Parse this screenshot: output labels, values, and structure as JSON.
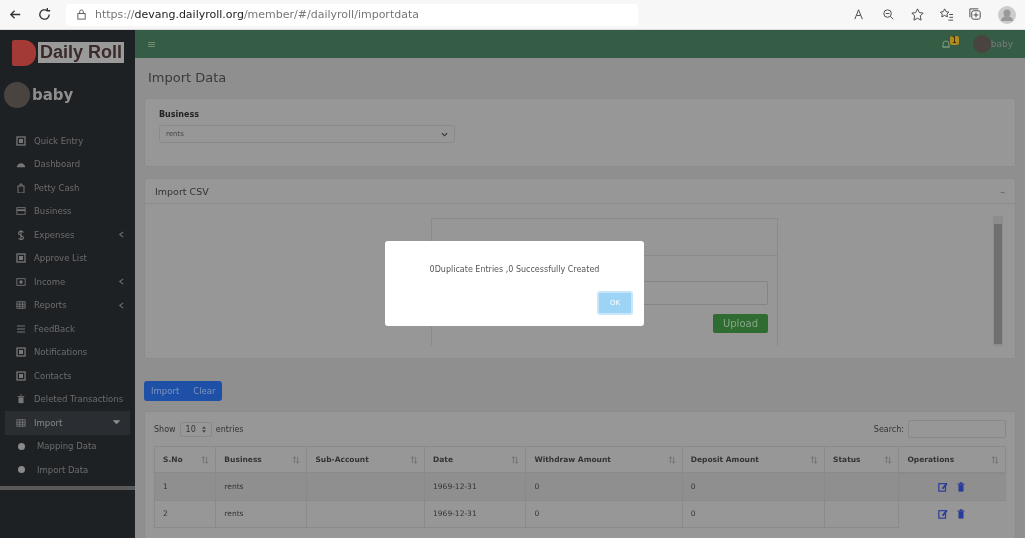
{
  "browser": {
    "url": "https://**devang.dailyroll.org**/member/#/dailyroll/importdata"
  },
  "sidebar": {
    "logo": "Daily Roll",
    "user": "baby",
    "items": [
      {
        "label": "Quick Entry",
        "kind": "link",
        "selected": false
      },
      {
        "label": "Dashboard",
        "kind": "link",
        "selected": false
      },
      {
        "label": "Petty Cash",
        "kind": "link",
        "selected": false
      },
      {
        "label": "Business",
        "kind": "link",
        "selected": false
      },
      {
        "label": "Expenses",
        "kind": "group",
        "expanded": false,
        "selected": false
      },
      {
        "label": "Approve List",
        "kind": "link",
        "selected": false
      },
      {
        "label": "Income",
        "kind": "group",
        "expanded": false,
        "selected": false
      },
      {
        "label": "Reports",
        "kind": "group",
        "expanded": false,
        "selected": false
      },
      {
        "label": "FeedBack",
        "kind": "link",
        "selected": false
      },
      {
        "label": "Notifications",
        "kind": "link",
        "selected": false
      },
      {
        "label": "Contacts",
        "kind": "link",
        "selected": false
      },
      {
        "label": "Deleted Transactions",
        "kind": "link",
        "selected": false
      },
      {
        "label": "Import",
        "kind": "group",
        "expanded": true,
        "selected": true,
        "children": [
          {
            "label": "Mapping Data"
          },
          {
            "label": "Import Data"
          }
        ]
      }
    ]
  },
  "navbar": {
    "menu": "≡",
    "notification_count": "1",
    "user": "baby"
  },
  "page_title": "Import Data",
  "business": {
    "label": "Business",
    "value": "rents"
  },
  "import_csv": {
    "title": "Import CSV",
    "collapse": "–",
    "upload": "Upload"
  },
  "buttons": [
    "Import",
    "Clear"
  ],
  "table": {
    "show": "Show",
    "page_size": "10",
    "entries": "entries",
    "search_label": "Search:",
    "columns": [
      "S.No",
      "Business",
      "Sub-Account",
      "Date",
      "Withdraw Amount",
      "Deposit Amount",
      "Status",
      "Operations"
    ],
    "rows": [
      {
        "s_no": "1",
        "business": "rents",
        "date": "1969-12-31",
        "withdraw_amount": "0",
        "deposit_amount": "0"
      },
      {
        "s_no": "2",
        "business": "rents",
        "date": "1969-12-31",
        "withdraw_amount": "0",
        "deposit_amount": "0"
      }
    ]
  },
  "dialog": {
    "message": "0Duplicate Entries ,0 Successfully Created",
    "ok": "OK"
  }
}
